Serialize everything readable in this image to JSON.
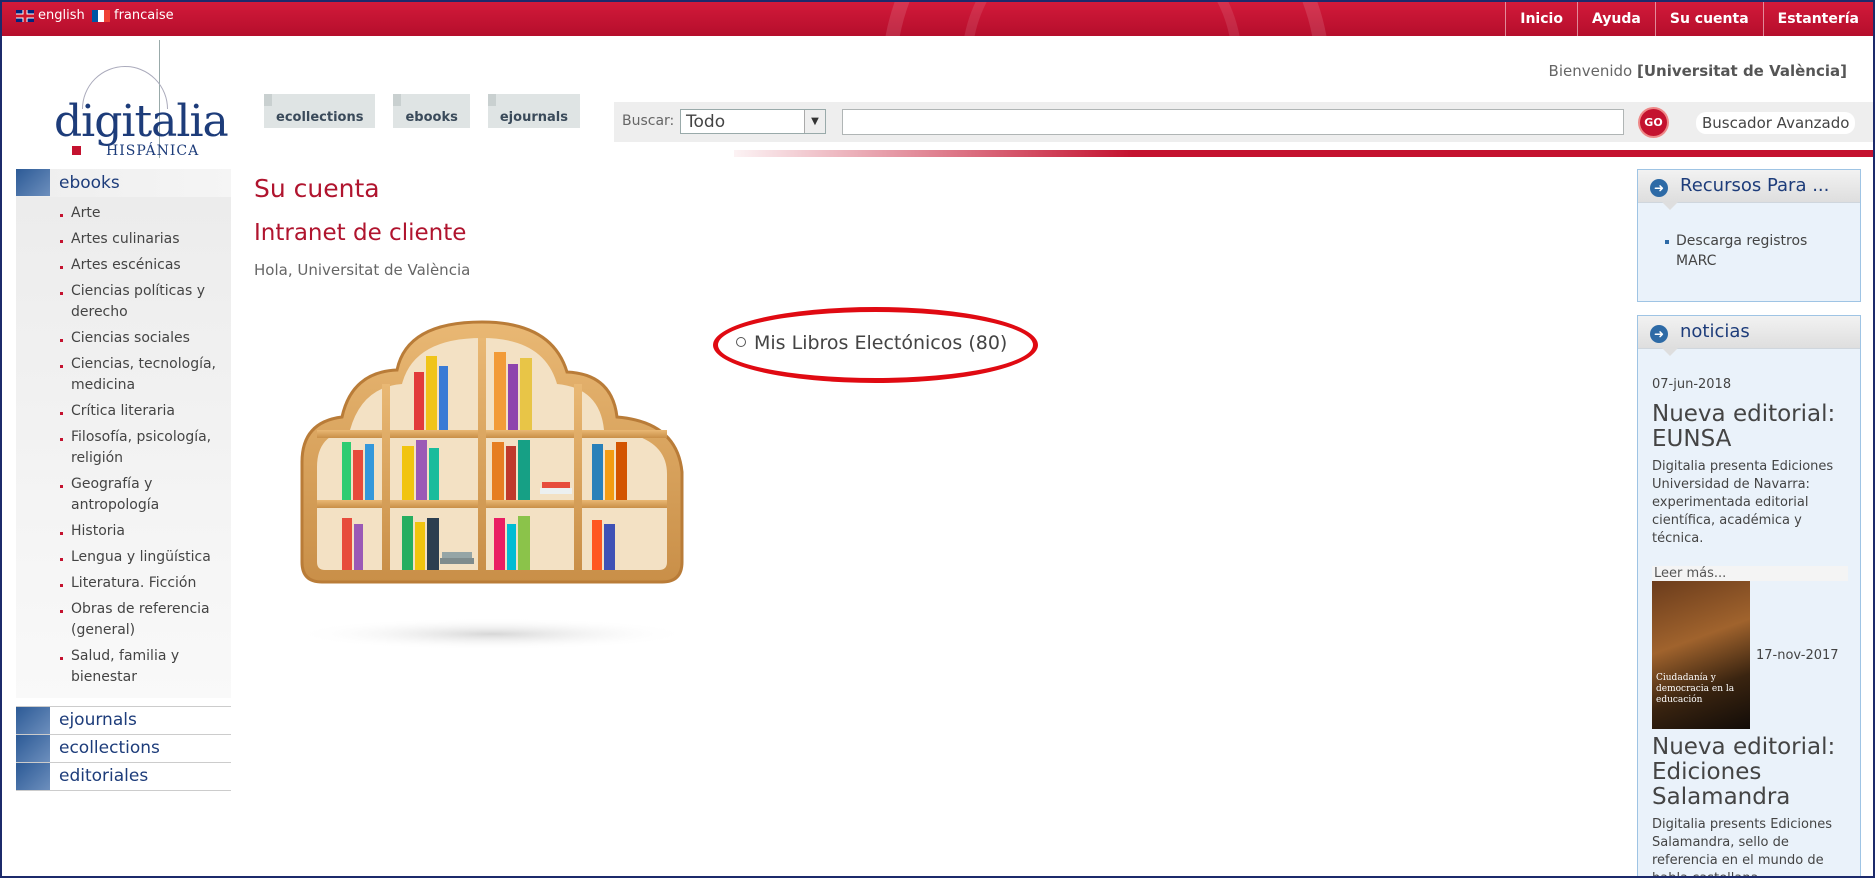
{
  "languages": [
    {
      "label": "english",
      "flag": "uk-flag-icon"
    },
    {
      "label": "francaise",
      "flag": "france-flag-icon"
    }
  ],
  "topnav": [
    "Inicio",
    "Ayuda",
    "Su cuenta",
    "Estantería"
  ],
  "logo": {
    "word": "digitalia",
    "sub": "HISPÁNICA"
  },
  "welcome": {
    "prefix": "Bienvenido",
    "user": "[Universitat de València]"
  },
  "tabs": [
    "ecollections",
    "ebooks",
    "ejournals"
  ],
  "search": {
    "label": "Buscar:",
    "scope": "Todo",
    "value": "",
    "go_label": "GO",
    "advanced_label": "Buscador Avanzado"
  },
  "sidebar": {
    "main": "ebooks",
    "subcategories": [
      "Arte",
      "Artes culinarias",
      "Artes escénicas",
      "Ciencias políticas y derecho",
      "Ciencias sociales",
      "Ciencias, tecnología, medicina",
      "Crítica literaria",
      "Filosofía, psicología, religión",
      "Geografía y antropología",
      "Historia",
      "Lengua y lingüística",
      "Literatura. Ficción",
      "Obras de referencia (general)",
      "Salud, familia y bienestar"
    ],
    "other": [
      "ejournals",
      "ecollections",
      "editoriales"
    ]
  },
  "main": {
    "title": "Su cuenta",
    "subtitle": "Intranet de cliente",
    "greeting": "Hola, Universitat de València",
    "link": "Mis Libros Electónicos (80)"
  },
  "right": {
    "recursos": {
      "title": "Recursos Para ...",
      "items": [
        "Descarga registros MARC"
      ]
    },
    "noticias": {
      "title": "noticias",
      "items": [
        {
          "date": "07-jun-2018",
          "title": "Nueva editorial: EUNSA",
          "text": "Digitalia presenta Ediciones Universidad de Navarra: experimentada editorial científica, académica y técnica.",
          "more": "Leer más..."
        },
        {
          "date": "17-nov-2017",
          "cover_title": "Ciudadanía y democracia en la educación",
          "title": "Nueva editorial: Ediciones Salamandra",
          "text": "Digitalia presents Ediciones Salamandra, sello de referencia en el mundo de habla castellana"
        }
      ]
    }
  },
  "colors": {
    "brand_red": "#c4122f",
    "brand_blue": "#1d3c7a",
    "highlight": "#e00a12"
  }
}
